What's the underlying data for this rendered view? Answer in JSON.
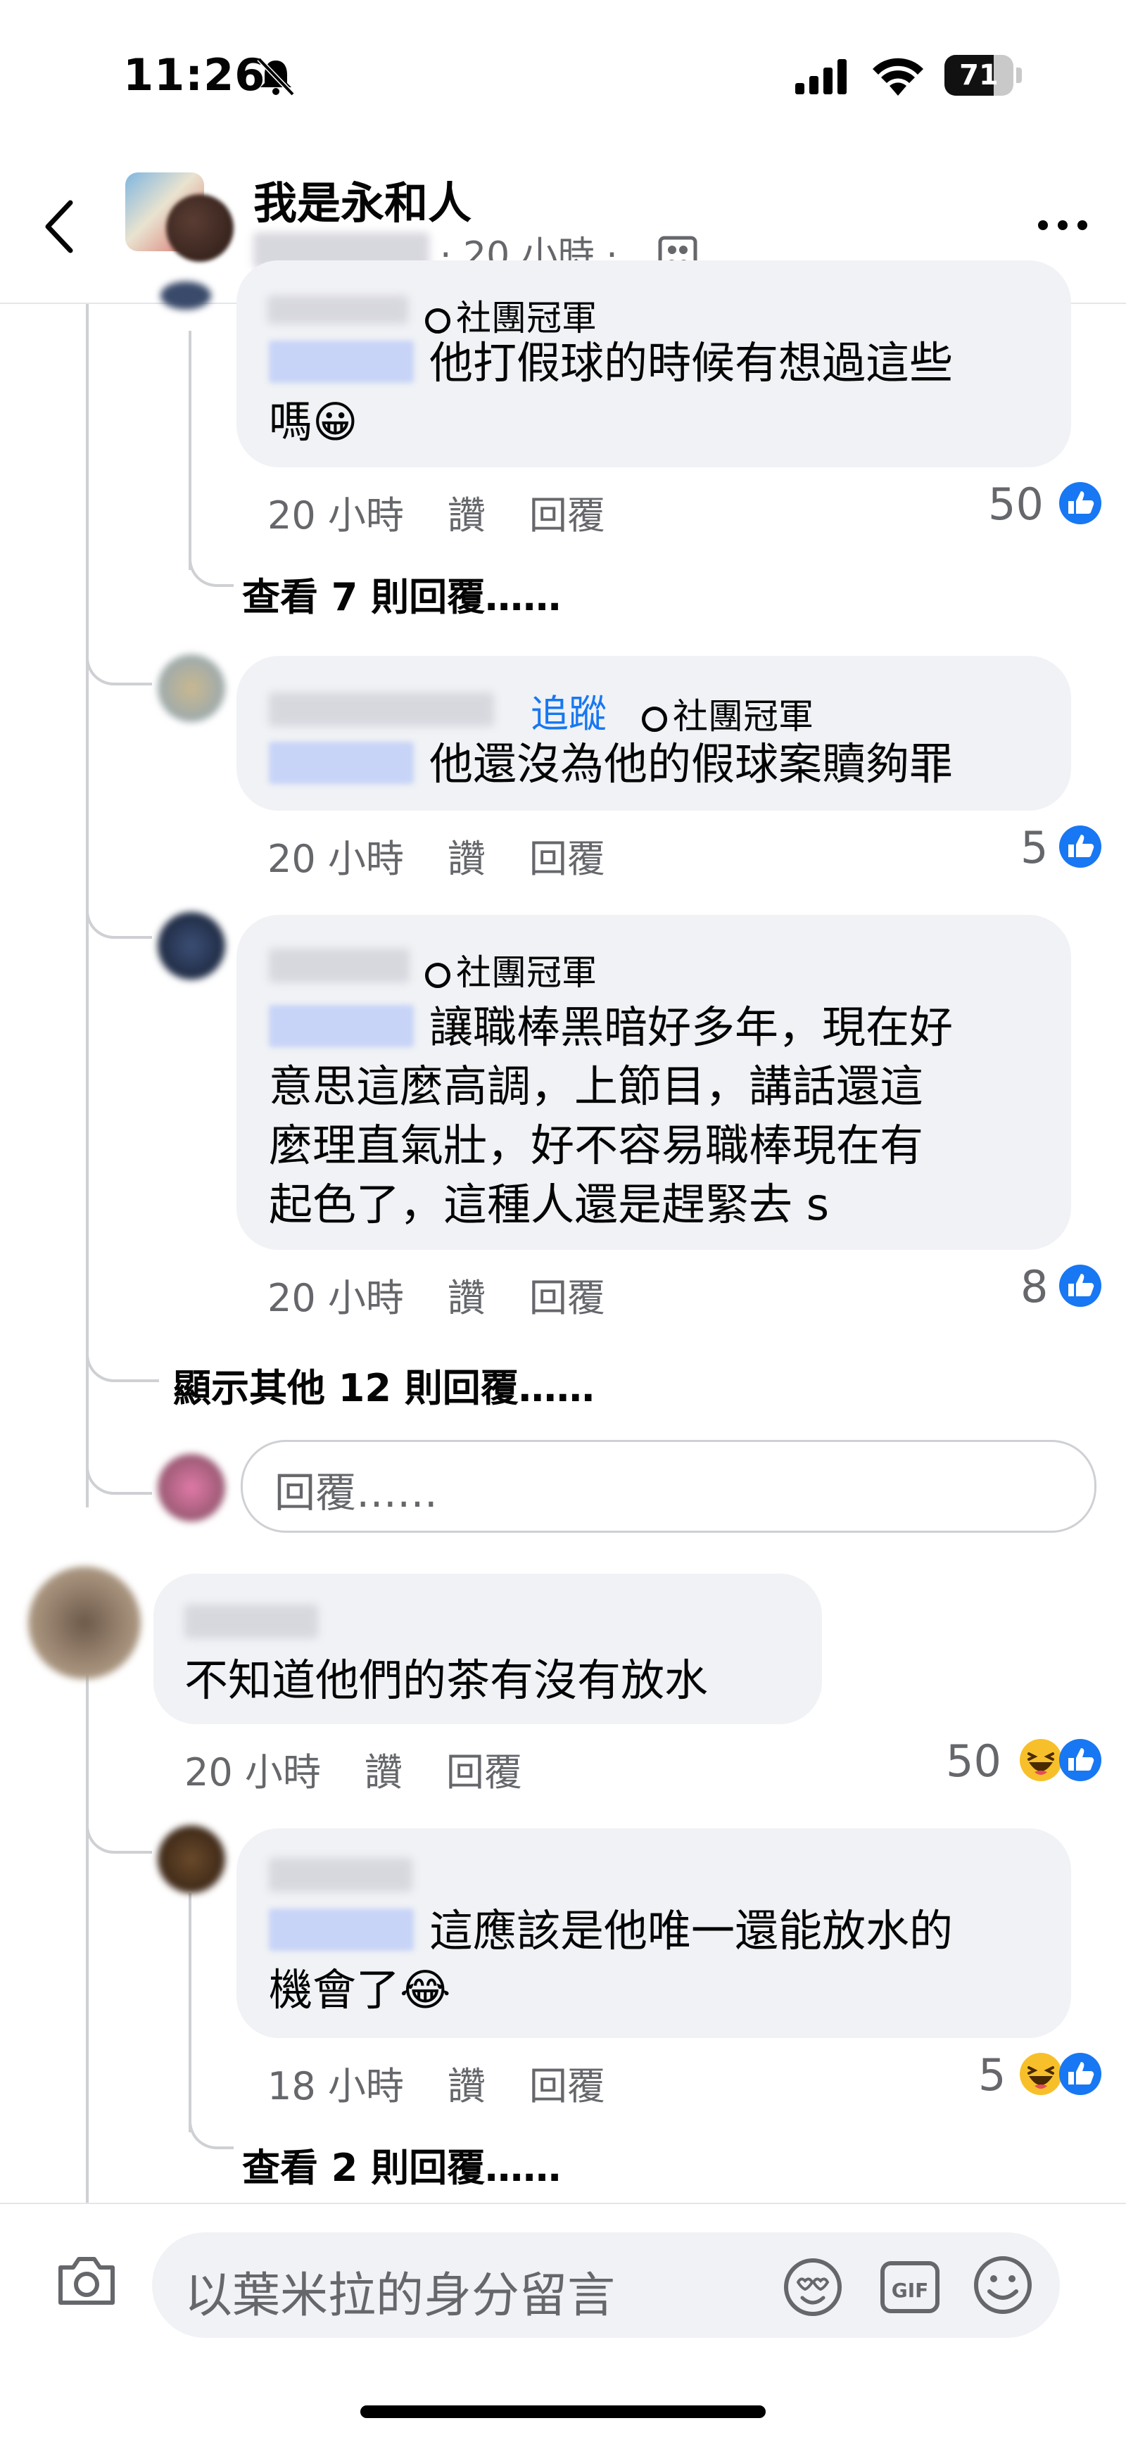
{
  "status_bar": {
    "time": "11:26",
    "battery": "71",
    "battery_level": 0.71
  },
  "header": {
    "group_name": "我是永和人",
    "post_time": "· 20 小時 ·"
  },
  "comments": [
    {
      "badge": "社團冠軍",
      "text_lines": [
        "他打假球的時候有想過這些",
        "嗎😀"
      ],
      "time": "20 小時",
      "like_label": "讚",
      "reply_label": "回覆",
      "reaction_count": "50",
      "reactions": [
        "like-icon"
      ],
      "view_replies": "查看 7 則回覆……"
    },
    {
      "follow_label": "追蹤",
      "badge": "社團冠軍",
      "text_lines": [
        "他還沒為他的假球案贖夠罪"
      ],
      "time": "20 小時",
      "like_label": "讚",
      "reply_label": "回覆",
      "reaction_count": "5",
      "reactions": [
        "like-icon"
      ]
    },
    {
      "badge": "社團冠軍",
      "text_lines": [
        "讓職棒黑暗好多年，現在好",
        "意思這麼高調，上節目，講話還這",
        "麼理直氣壯，好不容易職棒現在有",
        "起色了，這種人還是趕緊去 s"
      ],
      "time": "20 小時",
      "like_label": "讚",
      "reply_label": "回覆",
      "reaction_count": "8",
      "reactions": [
        "like-icon"
      ]
    },
    {
      "show_more_replies": "顯示其他 12 則回覆……",
      "reply_placeholder": "回覆……"
    },
    {
      "text_lines": [
        "不知道他們的茶有沒有放水"
      ],
      "time": "20 小時",
      "like_label": "讚",
      "reply_label": "回覆",
      "reaction_count": "50",
      "reactions": [
        "haha-icon",
        "like-icon"
      ]
    },
    {
      "text_lines": [
        "這應該是他唯一還能放水的",
        "機會了😂"
      ],
      "time": "18 小時",
      "like_label": "讚",
      "reply_label": "回覆",
      "reaction_count": "5",
      "reactions": [
        "haha-icon",
        "like-icon"
      ],
      "view_replies": "查看 2 則回覆……"
    }
  ],
  "composer": {
    "placeholder": "以葉米拉的身分留言"
  },
  "colors": {
    "like_blue": "#1877f2",
    "bubble_gray": "#f0f2f5",
    "meta_gray": "#65676b",
    "thread_line": "#ced0d4"
  }
}
